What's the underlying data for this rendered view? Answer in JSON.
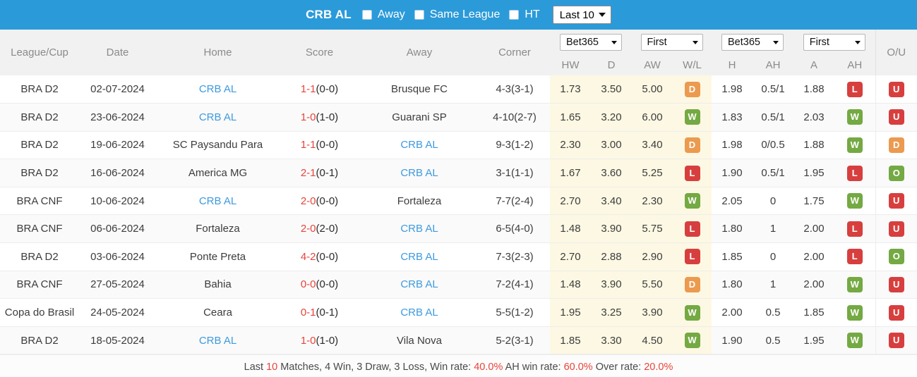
{
  "topbar": {
    "team": "CRB AL",
    "filters": [
      {
        "label": "Away",
        "checked": false
      },
      {
        "label": "Same League",
        "checked": false
      },
      {
        "label": "HT",
        "checked": false
      }
    ],
    "range_select": "Last 10",
    "bg_color": "#2b9ad9"
  },
  "table": {
    "columns": [
      "League/Cup",
      "Date",
      "Home",
      "Score",
      "Away",
      "Corner"
    ],
    "odds_group": {
      "bookmaker_select": "Bet365",
      "period_select": "First",
      "sub_headers": [
        "HW",
        "D",
        "AW",
        "W/L"
      ]
    },
    "ah_group": {
      "bookmaker_select": "Bet365",
      "period_select": "First",
      "sub_headers": [
        "H",
        "AH",
        "A",
        "AH"
      ]
    },
    "ou_header": "O/U",
    "rows": [
      {
        "league": "BRA D2",
        "date": "02-07-2024",
        "home": "CRB AL",
        "home_link": true,
        "score_main": "1-1",
        "score_ht": "(0-0)",
        "away": "Brusque FC",
        "away_link": false,
        "corner": "4-3(3-1)",
        "hw": "1.73",
        "d": "3.50",
        "aw": "5.00",
        "wl": "D",
        "h": "1.98",
        "ah1": "0.5/1",
        "a": "1.88",
        "ah2": "L",
        "ou": "U"
      },
      {
        "league": "BRA D2",
        "date": "23-06-2024",
        "home": "CRB AL",
        "home_link": true,
        "score_main": "1-0",
        "score_ht": "(1-0)",
        "away": "Guarani SP",
        "away_link": false,
        "corner": "4-10(2-7)",
        "hw": "1.65",
        "d": "3.20",
        "aw": "6.00",
        "wl": "W",
        "h": "1.83",
        "ah1": "0.5/1",
        "a": "2.03",
        "ah2": "W",
        "ou": "U"
      },
      {
        "league": "BRA D2",
        "date": "19-06-2024",
        "home": "SC Paysandu Para",
        "home_link": false,
        "score_main": "1-1",
        "score_ht": "(0-0)",
        "away": "CRB AL",
        "away_link": true,
        "corner": "9-3(1-2)",
        "hw": "2.30",
        "d": "3.00",
        "aw": "3.40",
        "wl": "D",
        "h": "1.98",
        "ah1": "0/0.5",
        "a": "1.88",
        "ah2": "W",
        "ou": "D"
      },
      {
        "league": "BRA D2",
        "date": "16-06-2024",
        "home": "America MG",
        "home_link": false,
        "score_main": "2-1",
        "score_ht": "(0-1)",
        "away": "CRB AL",
        "away_link": true,
        "corner": "3-1(1-1)",
        "hw": "1.67",
        "d": "3.60",
        "aw": "5.25",
        "wl": "L",
        "h": "1.90",
        "ah1": "0.5/1",
        "a": "1.95",
        "ah2": "L",
        "ou": "O"
      },
      {
        "league": "BRA CNF",
        "date": "10-06-2024",
        "home": "CRB AL",
        "home_link": true,
        "score_main": "2-0",
        "score_ht": "(0-0)",
        "away": "Fortaleza",
        "away_link": false,
        "corner": "7-7(2-4)",
        "hw": "2.70",
        "d": "3.40",
        "aw": "2.30",
        "wl": "W",
        "h": "2.05",
        "ah1": "0",
        "a": "1.75",
        "ah2": "W",
        "ou": "U"
      },
      {
        "league": "BRA CNF",
        "date": "06-06-2024",
        "home": "Fortaleza",
        "home_link": false,
        "score_main": "2-0",
        "score_ht": "(2-0)",
        "away": "CRB AL",
        "away_link": true,
        "corner": "6-5(4-0)",
        "hw": "1.48",
        "d": "3.90",
        "aw": "5.75",
        "wl": "L",
        "h": "1.80",
        "ah1": "1",
        "a": "2.00",
        "ah2": "L",
        "ou": "U"
      },
      {
        "league": "BRA D2",
        "date": "03-06-2024",
        "home": "Ponte Preta",
        "home_link": false,
        "score_main": "4-2",
        "score_ht": "(0-0)",
        "away": "CRB AL",
        "away_link": true,
        "corner": "7-3(2-3)",
        "hw": "2.70",
        "d": "2.88",
        "aw": "2.90",
        "wl": "L",
        "h": "1.85",
        "ah1": "0",
        "a": "2.00",
        "ah2": "L",
        "ou": "O"
      },
      {
        "league": "BRA CNF",
        "date": "27-05-2024",
        "home": "Bahia",
        "home_link": false,
        "score_main": "0-0",
        "score_ht": "(0-0)",
        "away": "CRB AL",
        "away_link": true,
        "corner": "7-2(4-1)",
        "hw": "1.48",
        "d": "3.90",
        "aw": "5.50",
        "wl": "D",
        "h": "1.80",
        "ah1": "1",
        "a": "2.00",
        "ah2": "W",
        "ou": "U"
      },
      {
        "league": "Copa do Brasil",
        "date": "24-05-2024",
        "home": "Ceara",
        "home_link": false,
        "score_main": "0-1",
        "score_ht": "(0-1)",
        "away": "CRB AL",
        "away_link": true,
        "corner": "5-5(1-2)",
        "hw": "1.95",
        "d": "3.25",
        "aw": "3.90",
        "wl": "W",
        "h": "2.00",
        "ah1": "0.5",
        "a": "1.85",
        "ah2": "W",
        "ou": "U"
      },
      {
        "league": "BRA D2",
        "date": "18-05-2024",
        "home": "CRB AL",
        "home_link": true,
        "score_main": "1-0",
        "score_ht": "(1-0)",
        "away": "Vila Nova",
        "away_link": false,
        "corner": "5-2(3-1)",
        "hw": "1.85",
        "d": "3.30",
        "aw": "4.50",
        "wl": "W",
        "h": "1.90",
        "ah1": "0.5",
        "a": "1.95",
        "ah2": "W",
        "ou": "U"
      }
    ]
  },
  "footer": {
    "p1": "Last ",
    "count": "10",
    "p2": " Matches, 4 Win, 3 Draw, 3 Loss, Win rate: ",
    "win_rate": "40.0%",
    "p3": " AH win rate: ",
    "ah_win_rate": "60.0%",
    "p4": " Over rate: ",
    "over_rate": "20.0%"
  },
  "colors": {
    "accent": "#2b9ad9",
    "link": "#3d9ae0",
    "score": "#e8443a",
    "win": "#74a943",
    "loss": "#d73f3f",
    "draw": "#eb9a4f",
    "odds_bg": "#fdf8e3"
  }
}
